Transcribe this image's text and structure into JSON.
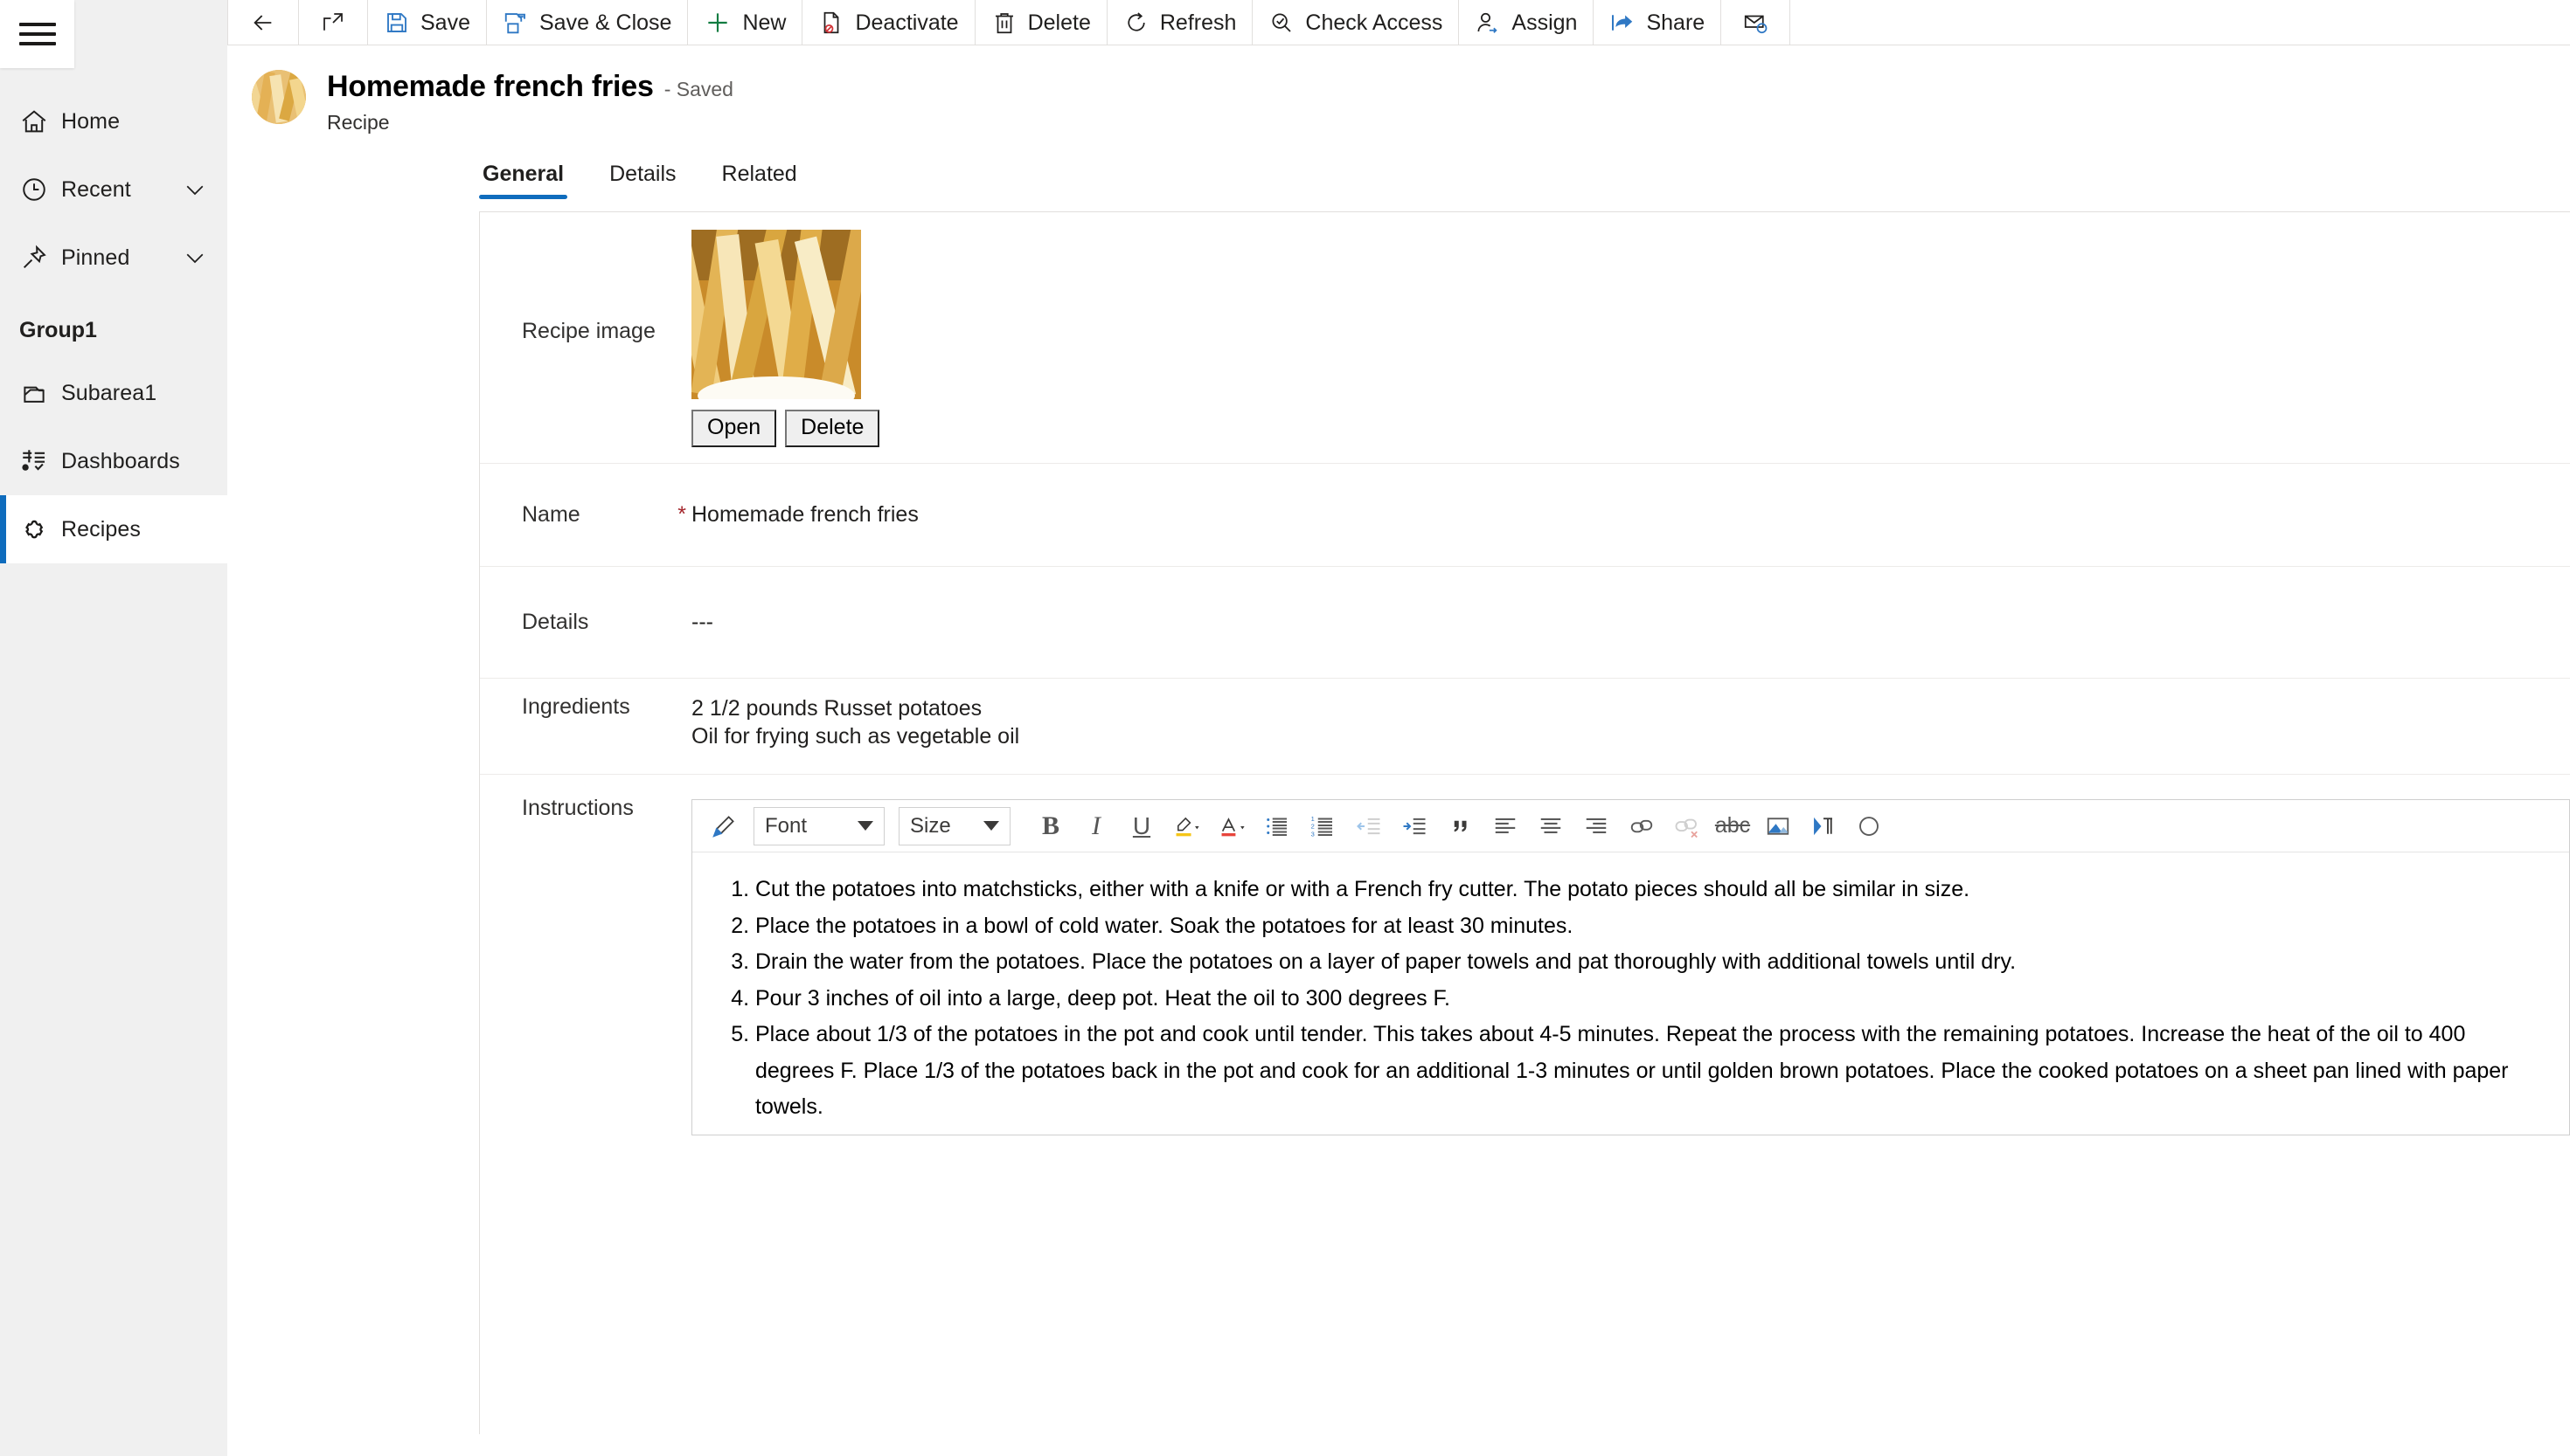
{
  "app": {
    "accent_color": "#0f6cbd",
    "sidebar_bg": "#f0f0f0",
    "required_color": "#a4262c"
  },
  "sidebar": {
    "menu_button": "hamburger-icon",
    "items": [
      {
        "label": "Home",
        "icon": "home-icon",
        "expandable": false,
        "selected": false
      },
      {
        "label": "Recent",
        "icon": "clock-icon",
        "expandable": true,
        "selected": false
      },
      {
        "label": "Pinned",
        "icon": "pin-icon",
        "expandable": true,
        "selected": false
      }
    ],
    "group": {
      "title": "Group1",
      "items": [
        {
          "label": "Subarea1",
          "icon": "subarea-icon",
          "selected": false
        },
        {
          "label": "Dashboards",
          "icon": "dashboard-icon",
          "selected": false
        },
        {
          "label": "Recipes",
          "icon": "puzzle-icon",
          "selected": true
        }
      ]
    }
  },
  "commandbar": {
    "items": [
      {
        "label": "",
        "icon": "back-arrow-icon",
        "icon_only": true
      },
      {
        "label": "",
        "icon": "popout-icon",
        "icon_only": true
      },
      {
        "label": "Save",
        "icon": "save-icon",
        "icon_only": false
      },
      {
        "label": "Save & Close",
        "icon": "save-close-icon",
        "icon_only": false
      },
      {
        "label": "New",
        "icon": "plus-icon",
        "icon_only": false
      },
      {
        "label": "Deactivate",
        "icon": "deactivate-icon",
        "icon_only": false
      },
      {
        "label": "Delete",
        "icon": "trash-icon",
        "icon_only": false
      },
      {
        "label": "Refresh",
        "icon": "refresh-icon",
        "icon_only": false
      },
      {
        "label": "Check Access",
        "icon": "check-access-icon",
        "icon_only": false
      },
      {
        "label": "Assign",
        "icon": "assign-user-icon",
        "icon_only": false
      },
      {
        "label": "Share",
        "icon": "share-icon",
        "icon_only": false
      },
      {
        "label": "",
        "icon": "email-link-icon",
        "icon_only": true
      }
    ]
  },
  "record": {
    "avatar": "recipe-thumbnail",
    "title": "Homemade french fries",
    "status": "- Saved",
    "entity": "Recipe"
  },
  "tabs": [
    {
      "label": "General",
      "active": true
    },
    {
      "label": "Details",
      "active": false
    },
    {
      "label": "Related",
      "active": false
    }
  ],
  "form": {
    "image_field": {
      "label": "Recipe image",
      "open_button": "Open",
      "delete_button": "Delete"
    },
    "fields": [
      {
        "label": "Name",
        "required": true,
        "value": "Homemade french fries"
      },
      {
        "label": "Details",
        "required": false,
        "value": "---"
      },
      {
        "label": "Ingredients",
        "required": false,
        "value": "2 1/2 pounds Russet potatoes\nOil for frying such as vegetable oil"
      },
      {
        "label": "Instructions",
        "required": false,
        "value": ""
      }
    ]
  },
  "rte": {
    "font_select": "Font",
    "size_select": "Size",
    "buttons": [
      "format-painter-icon",
      "bold-icon",
      "italic-icon",
      "underline-icon",
      "highlight-color-icon",
      "font-color-icon",
      "bulleted-list-icon",
      "numbered-list-icon",
      "decrease-indent-icon",
      "increase-indent-icon",
      "blockquote-icon",
      "align-left-icon",
      "align-center-icon",
      "align-right-icon",
      "insert-link-icon",
      "remove-link-icon",
      "strikethrough-icon",
      "insert-image-icon",
      "rtl-direction-icon"
    ],
    "instructions": [
      "Cut the potatoes into matchsticks, either with a knife or with a French fry cutter. The potato pieces should all be similar in size.",
      "Place the potatoes in a bowl of cold water. Soak the potatoes for at least 30 minutes.",
      "Drain the water from the potatoes. Place the potatoes on a layer of paper towels and pat thoroughly with additional towels until dry.",
      "Pour 3 inches of oil into a large, deep pot. Heat the oil to 300 degrees F.",
      "Place about 1/3 of the potatoes in the pot and cook until tender. This takes about 4-5 minutes. Repeat the process with the remaining potatoes. Increase the heat of the oil to 400 degrees F. Place 1/3 of the potatoes back in the pot and cook for an additional 1-3 minutes or until golden brown potatoes. Place the cooked potatoes on a sheet pan lined with paper towels."
    ]
  }
}
